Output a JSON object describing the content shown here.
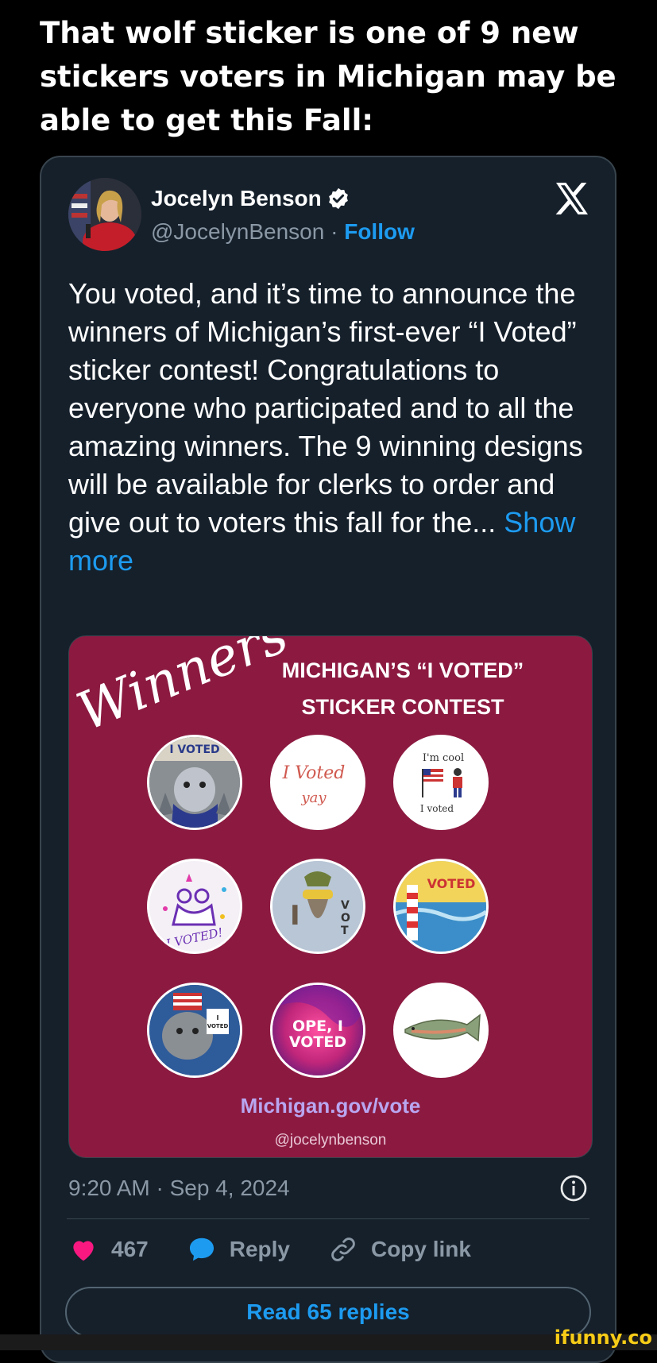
{
  "caption": "That wolf sticker is one of 9 new stickers voters in Michigan may be able to get this Fall:",
  "tweet": {
    "author_name": "Jocelyn Benson",
    "author_handle": "@JocelynBenson",
    "separator": " · ",
    "follow_label": "Follow",
    "text": "You voted, and it’s time to announce the winners of Michigan’s first-ever “I Voted” sticker contest! Congratulations to everyone who participated and to all the amazing winners. The 9 winning designs will be available for clerks to order and give out to voters this fall for the...",
    "show_more_label": "Show more",
    "timestamp": "9:20 AM · Sep 4, 2024",
    "likes": "467",
    "reply_label": "Reply",
    "copy_link_label": "Copy link",
    "read_replies_label": "Read 65 replies"
  },
  "media": {
    "winners_script": "Winners",
    "title_line1": "MICHIGAN’S “I VOTED”",
    "title_line2": "STICKER CONTEST",
    "url": "Michigan.gov/vote",
    "handle": "@jocelynbenson",
    "stickers": [
      {
        "name": "sticker-wolf-voter",
        "text": "I VOTED"
      },
      {
        "name": "sticker-i-voted-yay",
        "text": "I Voted yay"
      },
      {
        "name": "sticker-im-cool-i-voted",
        "text": "I'm cool  I voted"
      },
      {
        "name": "sticker-i-voted-doodle",
        "text": "I VOTED!"
      },
      {
        "name": "sticker-deer-i-vote",
        "text": "I VOTE"
      },
      {
        "name": "sticker-lighthouse-voted",
        "text": "VOTED"
      },
      {
        "name": "sticker-cat-i-voted",
        "text": "I VOTED"
      },
      {
        "name": "sticker-ope-i-voted",
        "text": "OPE, I VOTED"
      },
      {
        "name": "sticker-trout",
        "text": ""
      }
    ]
  },
  "watermark": "ifunny.co",
  "colors": {
    "background": "#000000",
    "card": "#15202b",
    "accent_blue": "#1d9bf0",
    "like_pink": "#f91880",
    "media_bg": "#8c1a40"
  }
}
